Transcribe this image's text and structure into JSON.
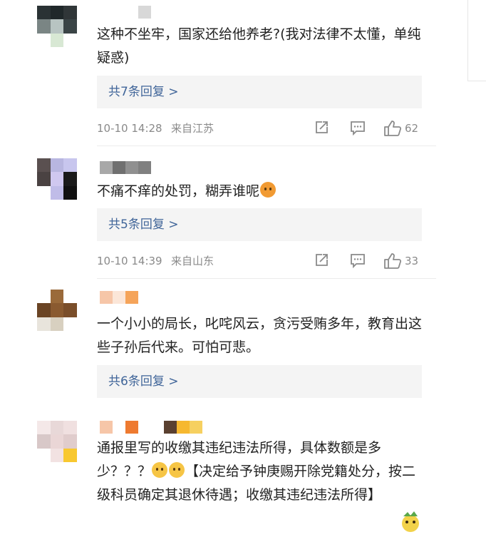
{
  "colors": {
    "link": "#406599",
    "meta": "#8a8a8a",
    "reply_bg": "#f4f4f4",
    "text": "#222222"
  },
  "comments": [
    {
      "text": "这种不坐牢，国家还给他养老?(我对法律不太懂，单纯疑惑)",
      "replies": "共7条回复 >",
      "time": "10-10 14:28",
      "location": "来自江苏",
      "likes": "62",
      "icons": [
        "share-icon",
        "comment-icon",
        "like-icon"
      ]
    },
    {
      "text": "不痛不痒的处罚，糊弄谁呢",
      "emoji": "angry-face-emoji",
      "replies": "共5条回复 >",
      "time": "10-10 14:39",
      "location": "来自山东",
      "likes": "33",
      "icons": [
        "share-icon",
        "comment-icon",
        "like-icon"
      ]
    },
    {
      "text": "一个小小的局长，叱咤风云，贪污受贿多年，教育出这些子孙后代来。可怕可悲。",
      "replies": "共6条回复 >"
    },
    {
      "text_before": "通报里写的收缴其违纪违法所得，具体数额是多少？？？",
      "emojis": [
        "smile-emoji",
        "smile-emoji"
      ],
      "text_after": "【决定给予钟庚赐开除党籍处分，按二级科员确定其退休待遇；收缴其违纪违法所得】"
    }
  ]
}
